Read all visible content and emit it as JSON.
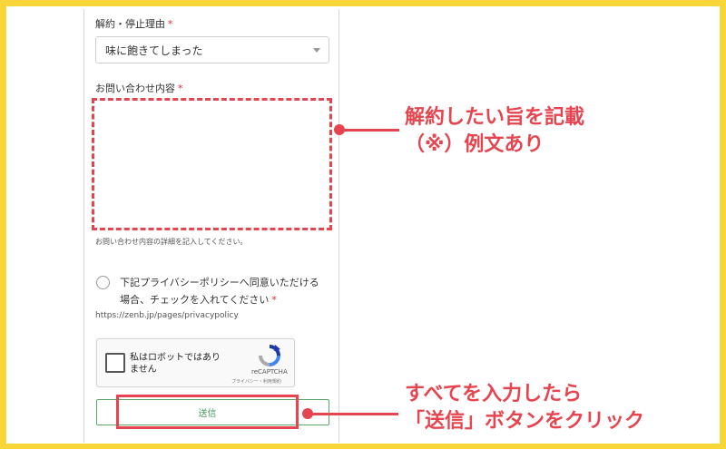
{
  "form": {
    "reason_label": "解約・停止理由",
    "required_mark": "*",
    "reason_selected": "味に飽きてしまった",
    "inquiry_label": "お問い合わせ内容",
    "inquiry_value": "",
    "inquiry_hint": "お問い合わせ内容の詳細を記入してください。",
    "consent_text": "下記プライバシーポリシーへ同意いただける場合、チェックを入れてください",
    "policy_url": "https://zenb.jp/pages/privacypolicy",
    "recaptcha": {
      "label_line1": "私はロボットではあり",
      "label_line2": "ません",
      "brand": "reCAPTCHA",
      "links": "プライバシー・利用規約"
    },
    "submit_label": "送信"
  },
  "annotations": {
    "callout_top_line1": "解約したい旨を記載",
    "callout_top_line2": "（※）例文あり",
    "callout_bottom_line1": "すべてを入力したら",
    "callout_bottom_line2": "「送信」ボタンをクリック"
  },
  "colors": {
    "frame": "#f8d63a",
    "highlight": "#e64550",
    "submit_text": "#4a9a5e",
    "required": "#e0283a"
  },
  "icons": {
    "select": "chevron-down-icon",
    "recaptcha": "recaptcha-logo-icon"
  }
}
